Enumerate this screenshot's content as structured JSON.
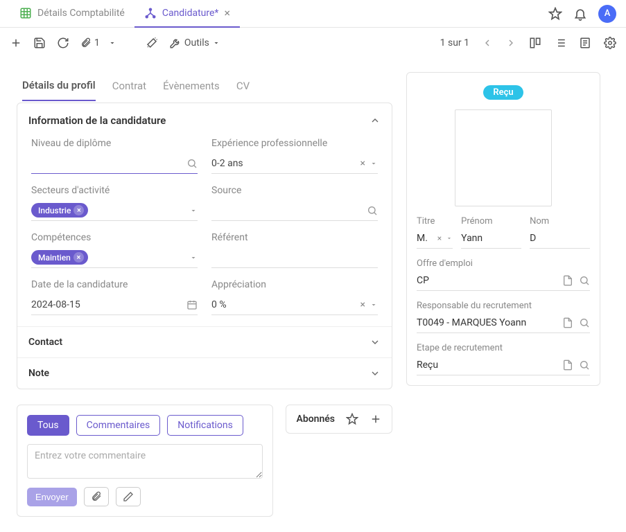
{
  "top_tabs": {
    "inactive": "Détails Comptabilité",
    "active": "Candidature*"
  },
  "avatar": "A",
  "toolbar": {
    "attach_count": "1",
    "tools_label": "Outils",
    "pager": "1 sur 1"
  },
  "subtabs": [
    "Détails du profil",
    "Contrat",
    "Évènements",
    "CV"
  ],
  "section": {
    "title": "Information de la candidature",
    "contact": "Contact",
    "note": "Note"
  },
  "fields": {
    "degree_label": "Niveau de diplôme",
    "experience_label": "Expérience professionnelle",
    "experience_value": "0-2 ans",
    "sectors_label": "Secteurs d'activité",
    "sector_chip": "Industrie",
    "source_label": "Source",
    "skills_label": "Compétences",
    "skill_chip": "Maintien",
    "referrer_label": "Référent",
    "date_label": "Date de la candidature",
    "date_value": "2024-08-15",
    "appreciation_label": "Appréciation",
    "appreciation_value": "0 %"
  },
  "right": {
    "status": "Reçu",
    "title_label": "Titre",
    "title_value": "M.",
    "firstname_label": "Prénom",
    "firstname_value": "Yann",
    "lastname_label": "Nom",
    "lastname_value": "D",
    "job_label": "Offre d'emploi",
    "job_value": "CP",
    "responsible_label": "Responsable du recrutement",
    "responsible_value": "T0049 - MARQUES Yoann",
    "stage_label": "Etape de recrutement",
    "stage_value": "Reçu"
  },
  "comments": {
    "filters": [
      "Tous",
      "Commentaires",
      "Notifications"
    ],
    "placeholder": "Entrez votre commentaire",
    "send": "Envoyer"
  },
  "followers": {
    "title": "Abonnés"
  }
}
